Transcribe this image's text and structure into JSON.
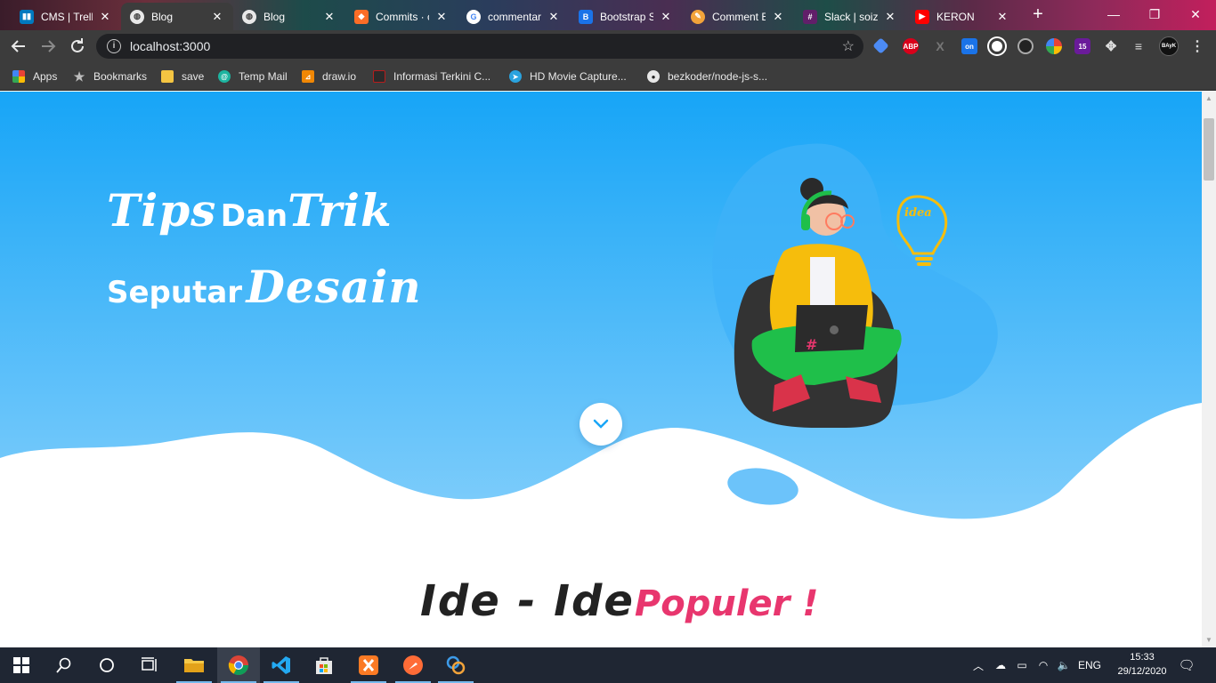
{
  "browser": {
    "tabs": [
      {
        "title": "CMS | Trello",
        "icon": "trello-icon",
        "color": "#0079bf",
        "active": false
      },
      {
        "title": "Blog",
        "icon": "globe-icon",
        "color": "#e8e8e8",
        "active": true
      },
      {
        "title": "Blog",
        "icon": "globe-icon",
        "color": "#e8e8e8",
        "active": false
      },
      {
        "title": "Commits · c",
        "icon": "gitlab-icon",
        "color": "#fc6d26",
        "active": false
      },
      {
        "title": "commentar",
        "icon": "google-icon",
        "color": "#4285f4",
        "active": false
      },
      {
        "title": "Bootstrap S",
        "icon": "bootstrap-icon",
        "color": "#563d7c",
        "active": false
      },
      {
        "title": "Comment B",
        "icon": "comment-icon",
        "color": "#f4b400",
        "active": false
      },
      {
        "title": "Slack | soize",
        "icon": "slack-icon",
        "color": "#611f69",
        "active": false
      },
      {
        "title": "KERON",
        "icon": "youtube-icon",
        "color": "#ff0000",
        "active": false
      }
    ],
    "new_tab": "+",
    "window_controls": {
      "minimize": "—",
      "restore": "❐",
      "close": "✕"
    },
    "address": "localhost:3000",
    "extensions": [
      {
        "name": "extension-blue-icon",
        "color": "#4c8bf5",
        "label": ""
      },
      {
        "name": "adblock-plus-icon",
        "color": "#d9001a",
        "label": "ABP"
      },
      {
        "name": "extension-x-icon",
        "color": "#555",
        "label": "X"
      },
      {
        "name": "extension-on-icon",
        "color": "#1a73e8",
        "label": "on"
      },
      {
        "name": "extension-cube-icon",
        "color": "#fff",
        "label": ""
      },
      {
        "name": "extension-eye-icon",
        "color": "#888",
        "label": ""
      },
      {
        "name": "extension-color-icon",
        "color": "#34a853",
        "label": ""
      },
      {
        "name": "extension-badge-icon",
        "color": "#6a1b9a",
        "label": "15"
      },
      {
        "name": "puzzle-icon",
        "color": "#3c3c3c",
        "label": ""
      },
      {
        "name": "playlist-icon",
        "color": "#3c3c3c",
        "label": ""
      },
      {
        "name": "profile-avatar",
        "color": "#111",
        "label": "BAyK"
      },
      {
        "name": "menu-dots-icon",
        "color": "#3c3c3c",
        "label": "⋮"
      }
    ],
    "bookmarks": [
      {
        "label": "Apps",
        "icon": "apps-icon",
        "color": "#ea4335"
      },
      {
        "label": "Bookmarks",
        "icon": "star-icon",
        "color": "#bdbdbd"
      },
      {
        "label": "save",
        "icon": "folder-icon",
        "color": "#f4c542"
      },
      {
        "label": "Temp Mail",
        "icon": "tempmail-icon",
        "color": "#1db4a0"
      },
      {
        "label": "draw.io",
        "icon": "drawio-icon",
        "color": "#f08705"
      },
      {
        "label": "Informasi Terkini C...",
        "icon": "news-icon",
        "color": "#b71c1c"
      },
      {
        "label": "HD Movie Capture...",
        "icon": "telegram-icon",
        "color": "#2aa3df"
      },
      {
        "label": "bezkoder/node-js-s...",
        "icon": "github-icon",
        "color": "#e8e8e8"
      }
    ]
  },
  "page": {
    "headline": {
      "line1_a": "Tips",
      "line1_b": "Dan",
      "line1_c": "Trik",
      "line2_a": "Seputar",
      "line2_b": "Desain"
    },
    "illustration_label": "idea",
    "scroll_button": "⌄",
    "section_title_dark": "Ide - Ide",
    "section_title_pink": "Populer !",
    "colors": {
      "hero_top": "#1aa6f7",
      "hero_bottom": "#7ccbfb",
      "accent_pink": "#e8366e",
      "title_dark": "#222222"
    }
  },
  "taskbar": {
    "apps": [
      {
        "name": "start-button",
        "icon": "windows-icon"
      },
      {
        "name": "search-button",
        "icon": "search-icon"
      },
      {
        "name": "cortana-button",
        "icon": "cortana-icon"
      },
      {
        "name": "task-view-button",
        "icon": "task-view-icon"
      },
      {
        "name": "file-explorer-app",
        "icon": "folder-icon"
      },
      {
        "name": "chrome-app",
        "icon": "chrome-icon"
      },
      {
        "name": "vscode-app",
        "icon": "vscode-icon"
      },
      {
        "name": "store-app",
        "icon": "store-icon"
      },
      {
        "name": "xampp-app",
        "icon": "xampp-icon"
      },
      {
        "name": "postman-app",
        "icon": "postman-icon"
      },
      {
        "name": "netbeans-app",
        "icon": "netbeans-icon"
      }
    ],
    "language": "ENG",
    "time": "15:33",
    "date": "29/12/2020"
  }
}
